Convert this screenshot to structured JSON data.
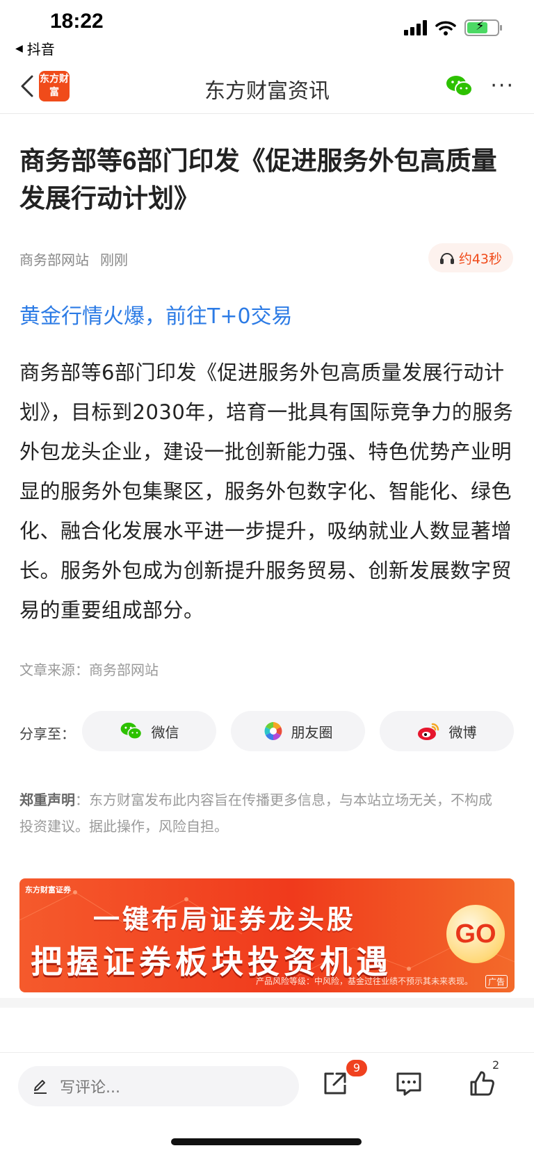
{
  "status_bar": {
    "time": "18:22",
    "back_app": "抖音",
    "icons": [
      "signal-icon",
      "wifi-icon",
      "battery-charging-icon"
    ]
  },
  "nav": {
    "logo_text": "东方财富",
    "title": "东方财富资讯",
    "icons": [
      "back-chevron-icon",
      "wechat-icon",
      "more-icon"
    ],
    "more_glyph": "···"
  },
  "article": {
    "title": "商务部等6部门印发《促进服务外包高质量发展行动计划》",
    "source_name": "商务部网站",
    "time": "刚刚",
    "listen_label": "约43秒",
    "promo_link": "黄金行情火爆，前往T+0交易",
    "body": "商务部等6部门印发《促进服务外包高质量发展行动计划》，目标到2030年，培育一批具有国际竞争力的服务外包龙头企业，建设一批创新能力强、特色优势产业明显的服务外包集聚区，服务外包数字化、智能化、绿色化、融合化发展水平进一步提升，吸纳就业人数显著增长。服务外包成为创新提升服务贸易、创新发展数字贸易的重要组成部分。",
    "source_line": "文章来源：商务部网站"
  },
  "share": {
    "label": "分享至：",
    "buttons": [
      {
        "label": "微信",
        "icon": "wechat-icon"
      },
      {
        "label": "朋友圈",
        "icon": "moments-icon"
      },
      {
        "label": "微博",
        "icon": "weibo-icon"
      }
    ]
  },
  "disclaimer": {
    "label": "郑重声明",
    "text": "：东方财富发布此内容旨在传播更多信息，与本站立场无关，不构成投资建议。据此操作，风险自担。"
  },
  "banner": {
    "brand": "东方财富证券",
    "line1": "一键布局证券龙头股",
    "line2": "把握证券板块投资机遇",
    "go_label": "GO",
    "risk_text": "产品风险等级：中风险，基金过往业绩不预示其未来表现。",
    "ad_label": "广告",
    "colors": {
      "primary": "#f03a1c",
      "accent": "#ffd97a"
    }
  },
  "bottom_bar": {
    "comment_placeholder": "写评论...",
    "share_count": "9",
    "like_count": "2",
    "icons": [
      "pencil-icon",
      "share-icon",
      "comment-icon",
      "like-icon"
    ]
  },
  "colors": {
    "brand": "#f04b1a",
    "link": "#2c7be5"
  }
}
